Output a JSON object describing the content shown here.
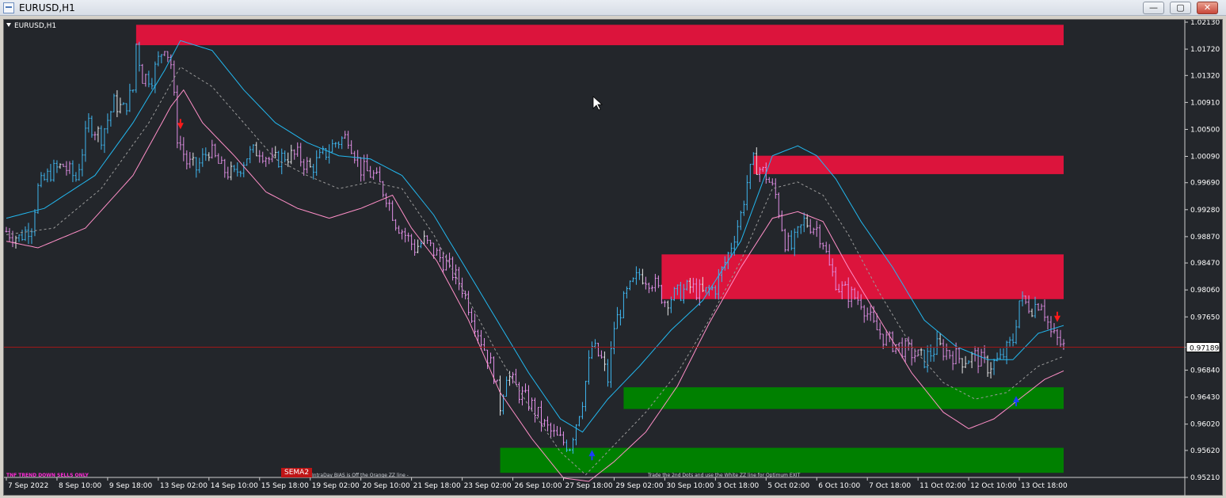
{
  "window": {
    "title": "EURUSD,H1",
    "buttons": {
      "minimize": "—",
      "maximize": "▢",
      "close": "✕"
    }
  },
  "chart": {
    "symbol_label": "EURUSD,H1",
    "current_price": "0.97189",
    "annotations": {
      "trend": "TNF TREND DOWN SELLS ONLY",
      "sema": "SEMA2",
      "bias": "IntraDay BIAS is Off the Orange ZZ line -",
      "exit": "Trade the 2nd Dots and use the White ZZ line for Optimum EXIT"
    },
    "colors": {
      "background": "#23262b",
      "bull_candle": "#3fb6ef",
      "bear_candle": "#e08fe5",
      "neutral_candle": "#e8e8e8",
      "supply_zone": "#dc143c",
      "demand_zone": "#008000",
      "upper_band": "#22b8f0",
      "lower_band": "#ff8fc8",
      "mid_line": "#9a9a9a",
      "price_line": "#a01818"
    }
  },
  "chart_data": {
    "type": "candlestick",
    "ylim": [
      0.9521,
      1.0213
    ],
    "y_ticks": [
      "1.02130",
      "1.01720",
      "1.01320",
      "1.00910",
      "1.00500",
      "1.00090",
      "0.99690",
      "0.99280",
      "0.98870",
      "0.98470",
      "0.98060",
      "0.97650",
      "0.97189",
      "0.96840",
      "0.96430",
      "0.96020",
      "0.95620",
      "0.95210"
    ],
    "x_ticks": [
      "7 Sep 2022",
      "8 Sep 10:00",
      "9 Sep 18:00",
      "13 Sep 02:00",
      "14 Sep 10:00",
      "15 Sep 18:00",
      "19 Sep 02:00",
      "20 Sep 10:00",
      "21 Sep 18:00",
      "23 Sep 02:00",
      "26 Sep 10:00",
      "27 Sep 18:00",
      "29 Sep 02:00",
      "30 Sep 10:00",
      "3 Oct 18:00",
      "5 Oct 02:00",
      "6 Oct 10:00",
      "7 Oct 18:00",
      "11 Oct 02:00",
      "12 Oct 10:00",
      "13 Oct 18:00"
    ],
    "x_tick_positions_bar": [
      0,
      16,
      32,
      48,
      64,
      80,
      96,
      112,
      128,
      144,
      160,
      176,
      192,
      208,
      224,
      240,
      256,
      272,
      288,
      304,
      320
    ],
    "total_bars": 335,
    "close_path": [
      [
        0,
        0.9895
      ],
      [
        4,
        0.9885
      ],
      [
        8,
        0.9905
      ],
      [
        10,
        0.996
      ],
      [
        14,
        0.9985
      ],
      [
        18,
        0.9995
      ],
      [
        22,
        0.9975
      ],
      [
        26,
        1.006
      ],
      [
        30,
        1.004
      ],
      [
        34,
        1.009
      ],
      [
        37,
        1.008
      ],
      [
        40,
        1.011
      ],
      [
        41,
        1.018
      ],
      [
        43,
        1.013
      ],
      [
        46,
        1.013
      ],
      [
        50,
        1.018
      ],
      [
        52,
        1.015
      ],
      [
        54,
        1.004
      ],
      [
        57,
        1.0
      ],
      [
        60,
        0.999
      ],
      [
        64,
        1.002
      ],
      [
        68,
        0.999
      ],
      [
        72,
        0.998
      ],
      [
        76,
        1.001
      ],
      [
        80,
        1.002
      ],
      [
        84,
        1.0
      ],
      [
        88,
        1.001
      ],
      [
        92,
        1.001
      ],
      [
        96,
        0.999
      ],
      [
        100,
        1.001
      ],
      [
        104,
        1.003
      ],
      [
        108,
        1.004
      ],
      [
        112,
        0.999
      ],
      [
        116,
        0.998
      ],
      [
        120,
        0.995
      ],
      [
        123,
        0.991
      ],
      [
        126,
        0.989
      ],
      [
        129,
        0.987
      ],
      [
        132,
        0.988
      ],
      [
        136,
        0.986
      ],
      [
        140,
        0.984
      ],
      [
        144,
        0.981
      ],
      [
        147,
        0.977
      ],
      [
        150,
        0.973
      ],
      [
        154,
        0.968
      ],
      [
        156,
        0.963
      ],
      [
        158,
        0.968
      ],
      [
        162,
        0.965
      ],
      [
        166,
        0.963
      ],
      [
        170,
        0.96
      ],
      [
        174,
        0.958
      ],
      [
        178,
        0.957
      ],
      [
        182,
        0.964
      ],
      [
        185,
        0.972
      ],
      [
        188,
        0.97
      ],
      [
        190,
        0.967
      ],
      [
        192,
        0.975
      ],
      [
        196,
        0.98
      ],
      [
        200,
        0.983
      ],
      [
        204,
        0.982
      ],
      [
        208,
        0.979
      ],
      [
        212,
        0.98
      ],
      [
        216,
        0.981
      ],
      [
        220,
        0.98
      ],
      [
        224,
        0.981
      ],
      [
        228,
        0.986
      ],
      [
        232,
        0.992
      ],
      [
        234,
        0.997
      ],
      [
        236,
        1.0
      ],
      [
        240,
        0.998
      ],
      [
        243,
        0.995
      ],
      [
        246,
        0.988
      ],
      [
        248,
        0.987
      ],
      [
        252,
        0.991
      ],
      [
        256,
        0.99
      ],
      [
        258,
        0.988
      ],
      [
        260,
        0.984
      ],
      [
        263,
        0.981
      ],
      [
        266,
        0.98
      ],
      [
        270,
        0.979
      ],
      [
        274,
        0.975
      ],
      [
        278,
        0.973
      ],
      [
        282,
        0.972
      ],
      [
        286,
        0.971
      ],
      [
        290,
        0.97
      ],
      [
        294,
        0.972
      ],
      [
        298,
        0.971
      ],
      [
        302,
        0.97
      ],
      [
        306,
        0.9705
      ],
      [
        310,
        0.969
      ],
      [
        314,
        0.97
      ],
      [
        318,
        0.973
      ],
      [
        320,
        0.979
      ],
      [
        324,
        0.978
      ],
      [
        327,
        0.979
      ],
      [
        330,
        0.974
      ],
      [
        334,
        0.9719
      ]
    ],
    "upper_band_path": [
      [
        0,
        0.9915
      ],
      [
        12,
        0.993
      ],
      [
        28,
        0.998
      ],
      [
        40,
        1.006
      ],
      [
        50,
        1.014
      ],
      [
        55,
        1.0185
      ],
      [
        65,
        1.017
      ],
      [
        75,
        1.011
      ],
      [
        85,
        1.006
      ],
      [
        95,
        1.003
      ],
      [
        105,
        1.001
      ],
      [
        115,
        1.0005
      ],
      [
        125,
        0.998
      ],
      [
        135,
        0.992
      ],
      [
        145,
        0.984
      ],
      [
        155,
        0.976
      ],
      [
        165,
        0.968
      ],
      [
        175,
        0.961
      ],
      [
        182,
        0.959
      ],
      [
        190,
        0.964
      ],
      [
        200,
        0.969
      ],
      [
        210,
        0.9745
      ],
      [
        220,
        0.979
      ],
      [
        232,
        0.988
      ],
      [
        242,
        1.001
      ],
      [
        250,
        1.0025
      ],
      [
        256,
        1.001
      ],
      [
        262,
        0.9975
      ],
      [
        270,
        0.991
      ],
      [
        280,
        0.984
      ],
      [
        290,
        0.976
      ],
      [
        300,
        0.972
      ],
      [
        310,
        0.97
      ],
      [
        318,
        0.97
      ],
      [
        326,
        0.974
      ],
      [
        334,
        0.9752
      ]
    ],
    "lower_band_path": [
      [
        0,
        0.988
      ],
      [
        10,
        0.987
      ],
      [
        25,
        0.99
      ],
      [
        40,
        0.998
      ],
      [
        52,
        1.0085
      ],
      [
        56,
        1.011
      ],
      [
        62,
        1.006
      ],
      [
        72,
        1.001
      ],
      [
        82,
        0.9955
      ],
      [
        92,
        0.993
      ],
      [
        102,
        0.9915
      ],
      [
        112,
        0.993
      ],
      [
        122,
        0.995
      ],
      [
        128,
        0.99
      ],
      [
        136,
        0.985
      ],
      [
        146,
        0.976
      ],
      [
        156,
        0.965
      ],
      [
        166,
        0.958
      ],
      [
        176,
        0.952
      ],
      [
        184,
        0.9515
      ],
      [
        192,
        0.9545
      ],
      [
        202,
        0.959
      ],
      [
        212,
        0.966
      ],
      [
        222,
        0.9755
      ],
      [
        232,
        0.984
      ],
      [
        242,
        0.9915
      ],
      [
        250,
        0.9925
      ],
      [
        258,
        0.991
      ],
      [
        266,
        0.984
      ],
      [
        276,
        0.976
      ],
      [
        286,
        0.968
      ],
      [
        296,
        0.962
      ],
      [
        304,
        0.9595
      ],
      [
        312,
        0.961
      ],
      [
        320,
        0.964
      ],
      [
        328,
        0.967
      ],
      [
        334,
        0.9683
      ]
    ],
    "mid_line_path": [
      [
        0,
        0.989
      ],
      [
        15,
        0.99
      ],
      [
        30,
        0.996
      ],
      [
        45,
        1.006
      ],
      [
        55,
        1.0145
      ],
      [
        65,
        1.0115
      ],
      [
        75,
        1.006
      ],
      [
        85,
        1.0005
      ],
      [
        95,
        0.998
      ],
      [
        105,
        0.996
      ],
      [
        115,
        0.997
      ],
      [
        125,
        0.996
      ],
      [
        135,
        0.989
      ],
      [
        145,
        0.98
      ],
      [
        155,
        0.971
      ],
      [
        165,
        0.963
      ],
      [
        175,
        0.956
      ],
      [
        183,
        0.9525
      ],
      [
        192,
        0.957
      ],
      [
        202,
        0.962
      ],
      [
        212,
        0.968
      ],
      [
        222,
        0.976
      ],
      [
        232,
        0.985
      ],
      [
        242,
        0.996
      ],
      [
        250,
        0.997
      ],
      [
        258,
        0.995
      ],
      [
        266,
        0.989
      ],
      [
        276,
        0.98
      ],
      [
        286,
        0.972
      ],
      [
        296,
        0.9665
      ],
      [
        306,
        0.964
      ],
      [
        316,
        0.965
      ],
      [
        326,
        0.969
      ],
      [
        334,
        0.9705
      ]
    ],
    "zones": [
      {
        "type": "supply",
        "from_bar": 41,
        "to_bar": 334,
        "top": 1.0209,
        "bottom": 1.0178
      },
      {
        "type": "supply",
        "from_bar": 236,
        "to_bar": 334,
        "top": 1.001,
        "bottom": 0.9982
      },
      {
        "type": "supply",
        "from_bar": 207,
        "to_bar": 334,
        "top": 0.986,
        "bottom": 0.9792
      },
      {
        "type": "demand",
        "from_bar": 195,
        "to_bar": 334,
        "top": 0.9658,
        "bottom": 0.9625
      },
      {
        "type": "demand",
        "from_bar": 156,
        "to_bar": 334,
        "top": 0.9566,
        "bottom": 0.9528
      }
    ],
    "arrows": [
      {
        "direction": "down",
        "bar": 55,
        "price": 1.0055
      },
      {
        "direction": "up",
        "bar": 185,
        "price": 0.9558
      },
      {
        "direction": "up",
        "bar": 319,
        "price": 0.964
      },
      {
        "direction": "down",
        "bar": 332,
        "price": 0.9762
      }
    ],
    "grid": false
  }
}
